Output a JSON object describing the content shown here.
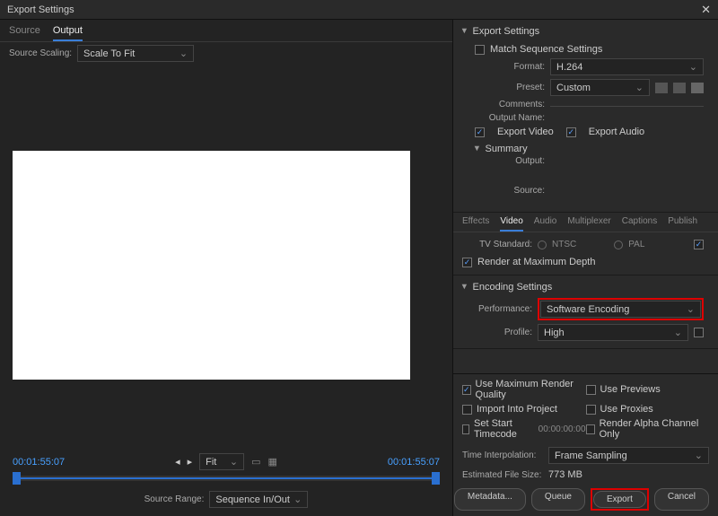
{
  "title": "Export Settings",
  "left": {
    "tabs": [
      "Source",
      "Output"
    ],
    "activeTab": 1,
    "sourceScalingLabel": "Source Scaling:",
    "sourceScalingValue": "Scale To Fit",
    "tc_left": "00:01:55:07",
    "tc_right": "00:01:55:07",
    "fitLabel": "Fit",
    "sourceRangeLabel": "Source Range:",
    "sourceRangeValue": "Sequence In/Out"
  },
  "right": {
    "exportSettingsTitle": "Export Settings",
    "matchSeq": "Match Sequence Settings",
    "formatLabel": "Format:",
    "formatValue": "H.264",
    "presetLabel": "Preset:",
    "presetValue": "Custom",
    "commentsLabel": "Comments:",
    "outputNameLabel": "Output Name:",
    "exportVideo": "Export Video",
    "exportAudio": "Export Audio",
    "summaryTitle": "Summary",
    "outputLabel": "Output:",
    "sourceLabel": "Source:",
    "subtabs": [
      "Effects",
      "Video",
      "Audio",
      "Multiplexer",
      "Captions",
      "Publish"
    ],
    "activeSubtab": 1,
    "tvStandard": "TV Standard:",
    "ntsc": "NTSC",
    "pal": "PAL",
    "renderMaxDepth": "Render at Maximum Depth",
    "encodingTitle": "Encoding Settings",
    "performanceLabel": "Performance:",
    "performanceValue": "Software Encoding",
    "profileLabel": "Profile:",
    "profileValue": "High",
    "useMaxRender": "Use Maximum Render Quality",
    "usePreviews": "Use Previews",
    "importProject": "Import Into Project",
    "useProxies": "Use Proxies",
    "setStartTC": "Set Start Timecode",
    "startTC": "00:00:00:00",
    "renderAlpha": "Render Alpha Channel Only",
    "timeInterpLabel": "Time Interpolation:",
    "timeInterpValue": "Frame Sampling",
    "estSizeLabel": "Estimated File Size:",
    "estSizeValue": "773 MB",
    "btnMetadata": "Metadata...",
    "btnQueue": "Queue",
    "btnExport": "Export",
    "btnCancel": "Cancel"
  }
}
